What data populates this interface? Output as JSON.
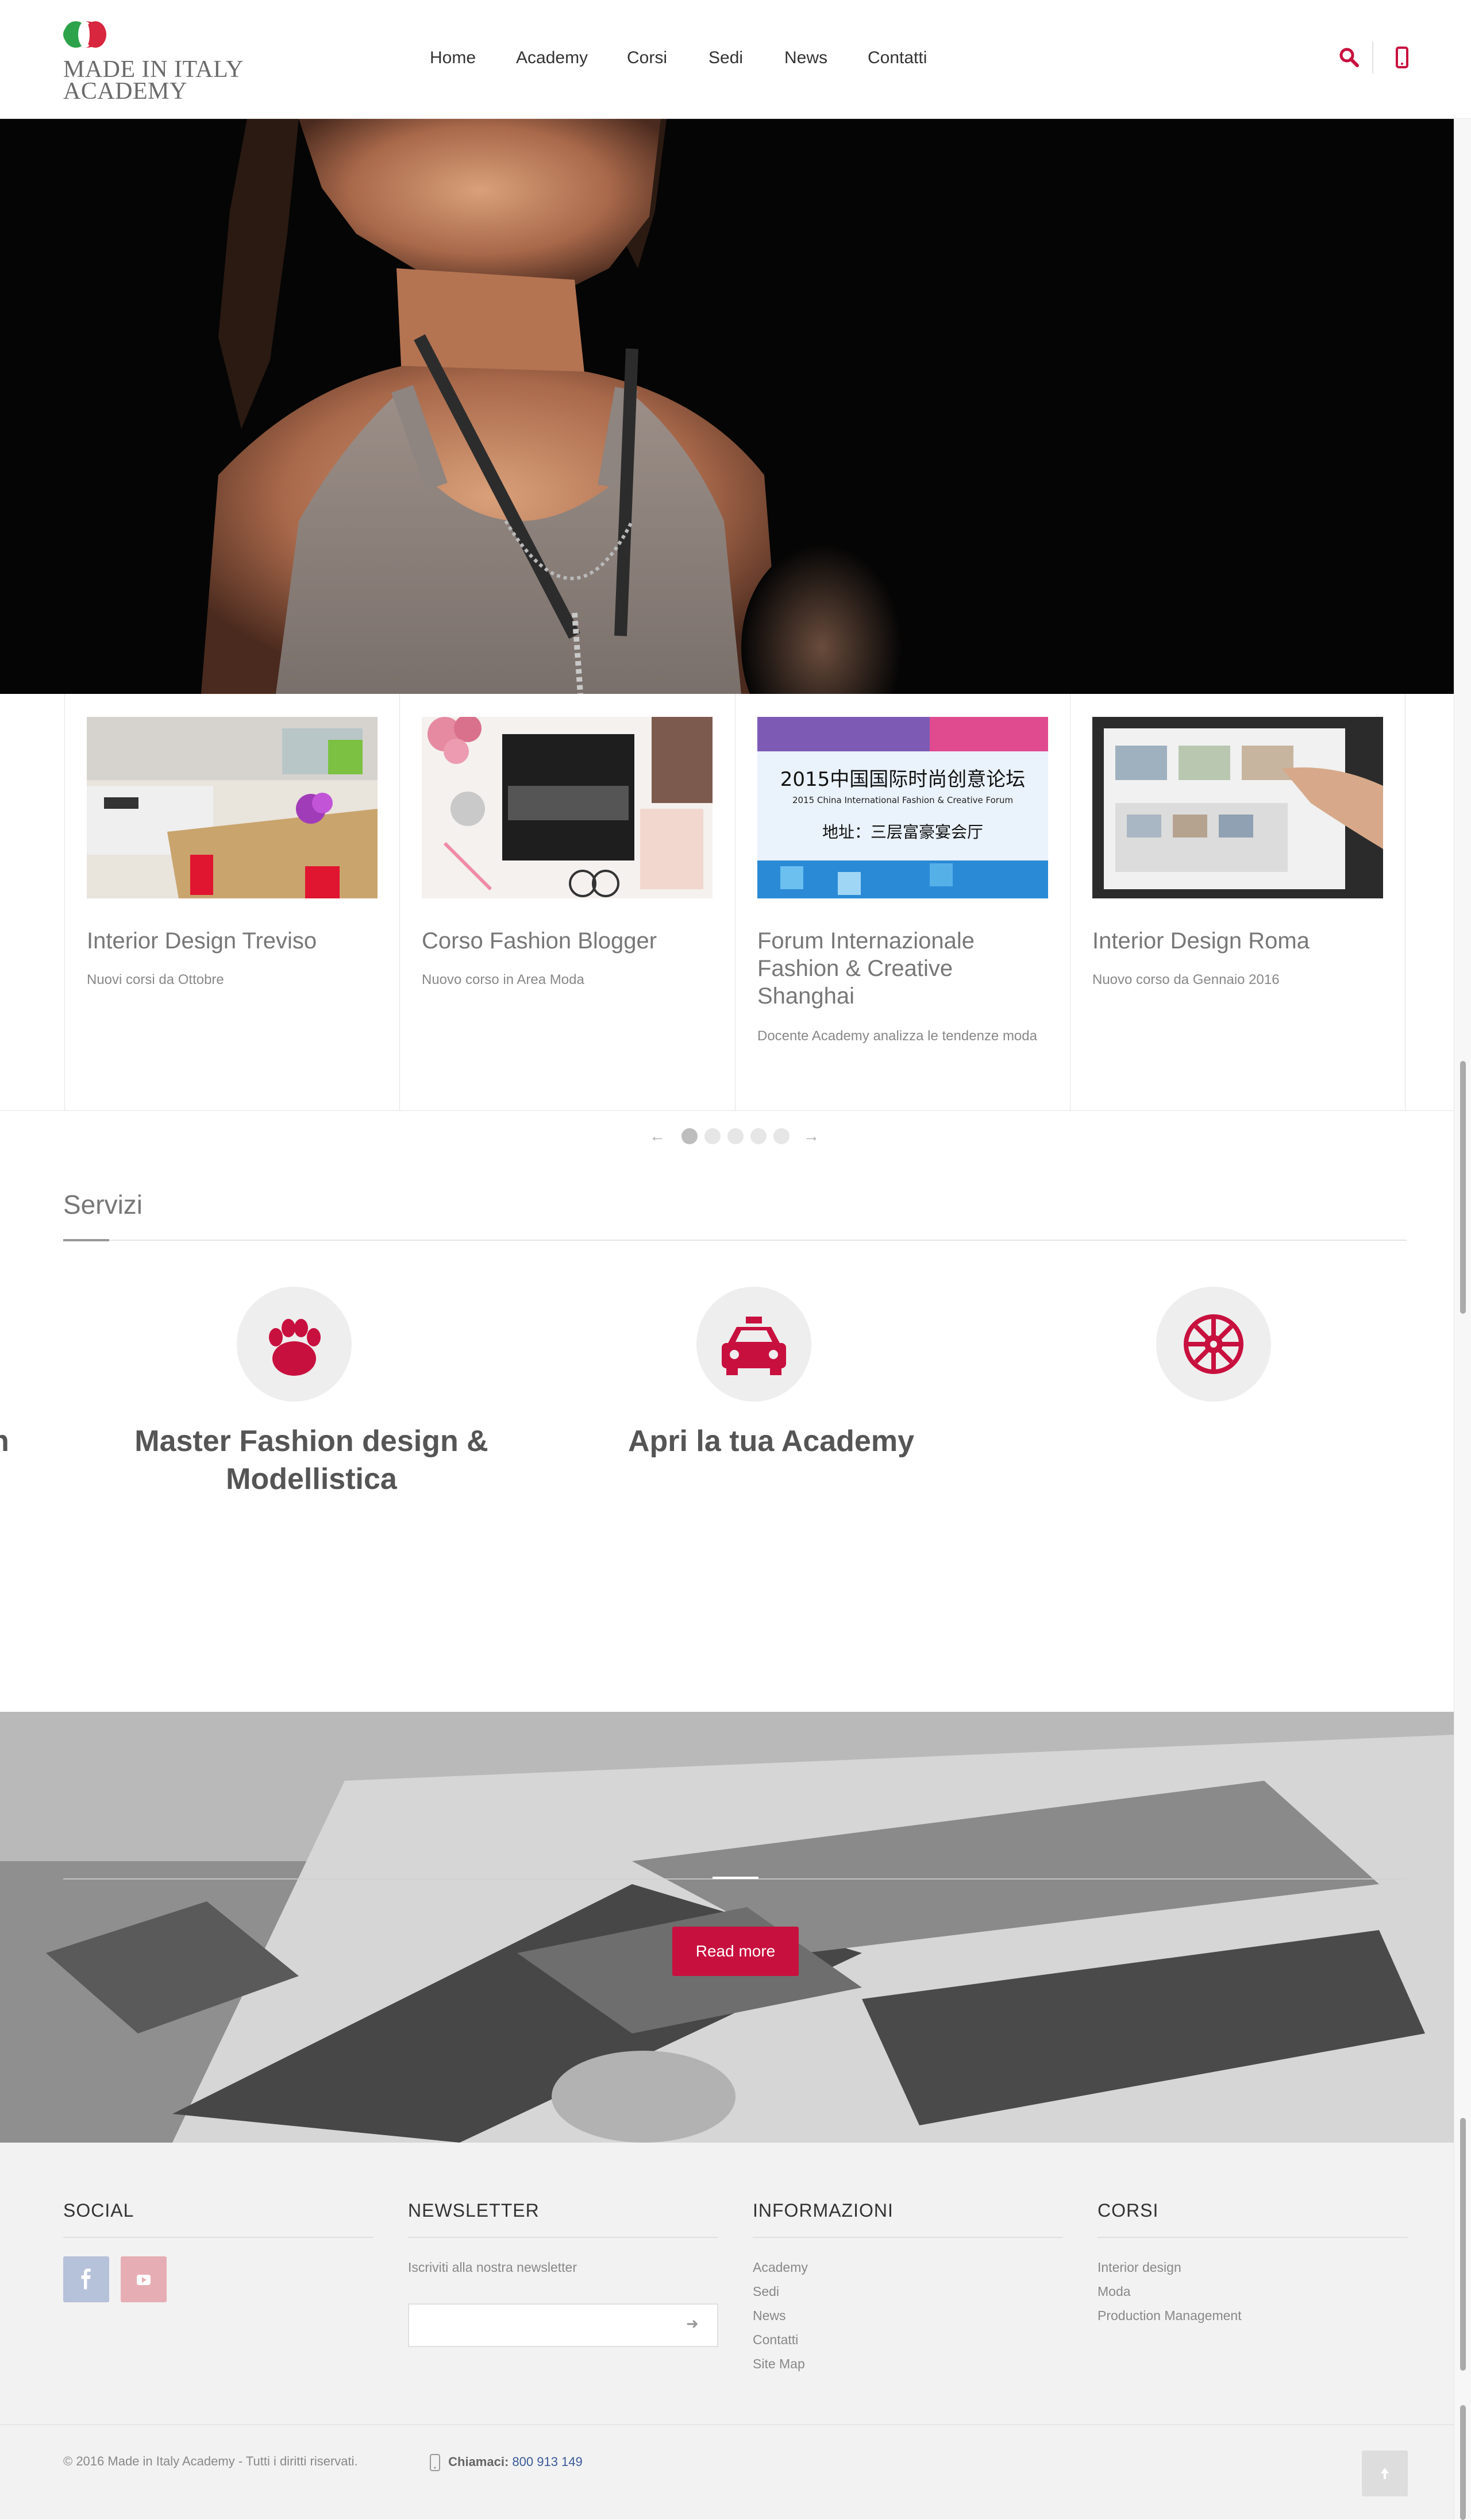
{
  "header": {
    "brand_line1": "MADE IN ITALY",
    "brand_line2": "ACADEMY",
    "nav": [
      "Home",
      "Academy",
      "Corsi",
      "Sedi",
      "News",
      "Contatti"
    ],
    "icons": [
      "search-icon",
      "phone-icon"
    ],
    "accent_color": "#c8103e"
  },
  "news": {
    "items": [
      {
        "title": "Interior Design Treviso",
        "subtitle": "Nuovi corsi da Ottobre"
      },
      {
        "title": "Corso Fashion Blogger",
        "subtitle": "Nuovo corso in Area Moda"
      },
      {
        "title": "Forum Internazionale Fashion & Creative Shanghai",
        "subtitle": "Docente Academy analizza le tendenze moda"
      },
      {
        "title": "Interior Design Roma",
        "subtitle": "Nuovo corso da Gennaio 2016"
      }
    ],
    "screen_text_line1": "2015中国国际时尚创意论坛",
    "screen_text_line2": "2015 China International Fashion & Creative Forum",
    "screen_text_line3": "地址：三层富豪宴会厅",
    "pager_count": 5,
    "pager_active": 1
  },
  "services": {
    "title": "Servizi",
    "partial_left": "n",
    "items": [
      {
        "title_line1": "Master Fashion design &",
        "title_line2": "Modellistica",
        "icon": "paw-icon"
      },
      {
        "title_line1": "Apri la tua Academy",
        "title_line2": "",
        "icon": "taxi-icon"
      },
      {
        "title_line1": "",
        "title_line2": "",
        "icon": "empire-icon"
      }
    ]
  },
  "parallax": {
    "button": "Read more"
  },
  "footer": {
    "social": {
      "title": "SOCIAL",
      "icons": [
        "facebook-icon",
        "youtube-icon"
      ]
    },
    "newsletter": {
      "title": "NEWSLETTER",
      "text": "Iscriviti alla nostra newsletter",
      "input_value": ""
    },
    "info": {
      "title": "INFORMAZIONI",
      "links": [
        "Academy",
        "Sedi",
        "News",
        "Contatti",
        "Site Map"
      ]
    },
    "corsi": {
      "title": "CORSI",
      "links": [
        "Interior design",
        "Moda",
        "Production Management"
      ]
    },
    "copyright": "© 2016 Made in Italy Academy - Tutti i diritti riservati.",
    "call_label": "Chiamaci:",
    "call_number": "800 913 149"
  }
}
